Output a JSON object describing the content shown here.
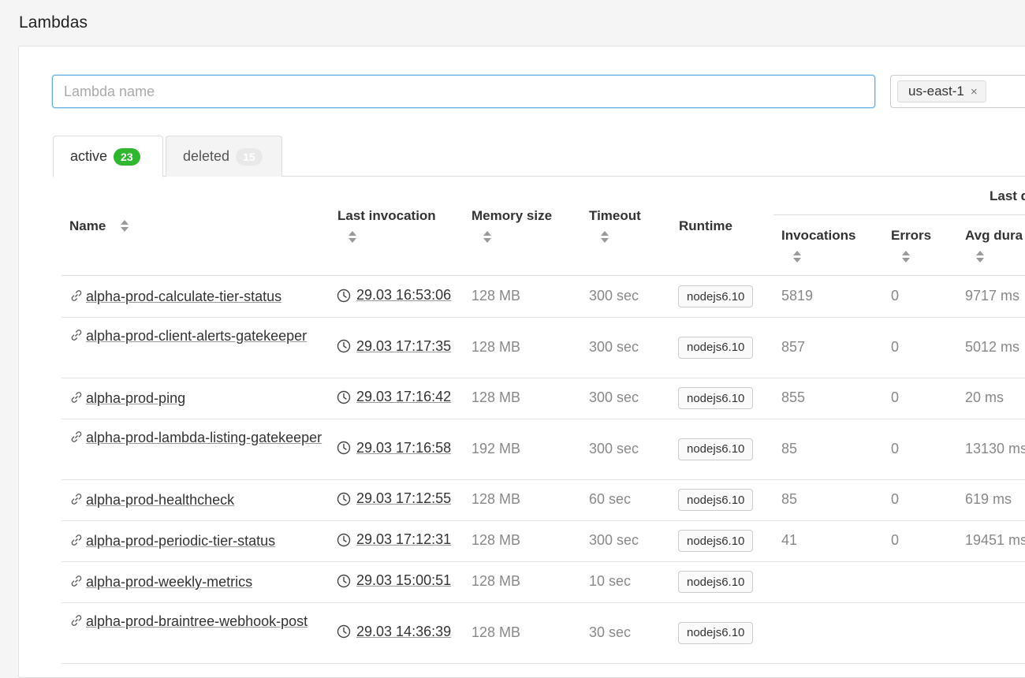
{
  "page": {
    "title": "Lambdas"
  },
  "search": {
    "placeholder": "Lambda name",
    "value": ""
  },
  "region_filter": {
    "selected": "us-east-1",
    "remove_glyph": "×"
  },
  "tabs": [
    {
      "label": "active",
      "count": "23",
      "active": true
    },
    {
      "label": "deleted",
      "count": "15",
      "active": false
    }
  ],
  "table": {
    "headers": {
      "name": "Name",
      "last_invocation": "Last invocation",
      "memory_size": "Memory size",
      "timeout": "Timeout",
      "runtime": "Runtime",
      "group": "Last d",
      "invocations": "Invocations",
      "errors": "Errors",
      "avg_duration": "Avg dura"
    },
    "rows": [
      {
        "name": "alpha-prod-calculate-tier-status",
        "last_invocation": "29.03 16:53:06",
        "memory": "128 MB",
        "timeout": "300 sec",
        "runtime": "nodejs6.10",
        "invocations": "5819",
        "errors": "0",
        "avg_duration": "9717 ms"
      },
      {
        "name": "alpha-prod-client-alerts-gatekeeper",
        "last_invocation": "29.03 17:17:35",
        "memory": "128 MB",
        "timeout": "300 sec",
        "runtime": "nodejs6.10",
        "invocations": "857",
        "errors": "0",
        "avg_duration": "5012 ms"
      },
      {
        "name": "alpha-prod-ping",
        "last_invocation": "29.03 17:16:42",
        "memory": "128 MB",
        "timeout": "300 sec",
        "runtime": "nodejs6.10",
        "invocations": "855",
        "errors": "0",
        "avg_duration": "20 ms"
      },
      {
        "name": "alpha-prod-lambda-listing-gatekeeper",
        "last_invocation": "29.03 17:16:58",
        "memory": "192 MB",
        "timeout": "300 sec",
        "runtime": "nodejs6.10",
        "invocations": "85",
        "errors": "0",
        "avg_duration": "13130 ms"
      },
      {
        "name": "alpha-prod-healthcheck",
        "last_invocation": "29.03 17:12:55",
        "memory": "128 MB",
        "timeout": "60 sec",
        "runtime": "nodejs6.10",
        "invocations": "85",
        "errors": "0",
        "avg_duration": "619 ms"
      },
      {
        "name": "alpha-prod-periodic-tier-status",
        "last_invocation": "29.03 17:12:31",
        "memory": "128 MB",
        "timeout": "300 sec",
        "runtime": "nodejs6.10",
        "invocations": "41",
        "errors": "0",
        "avg_duration": "19451 ms"
      },
      {
        "name": "alpha-prod-weekly-metrics",
        "last_invocation": "29.03 15:00:51",
        "memory": "128 MB",
        "timeout": "10 sec",
        "runtime": "nodejs6.10",
        "invocations": "",
        "errors": "",
        "avg_duration": ""
      },
      {
        "name": "alpha-prod-braintree-webhook-post",
        "last_invocation": "29.03 14:36:39",
        "memory": "128 MB",
        "timeout": "30 sec",
        "runtime": "nodejs6.10",
        "invocations": "",
        "errors": "",
        "avg_duration": ""
      }
    ]
  },
  "colors": {
    "accent_focus": "#66afe9",
    "active_badge": "#2fb72f",
    "deleted_badge": "#e9e9e9"
  },
  "icons": {
    "row_link": "link-icon",
    "row_time": "clock-icon",
    "sort": "sort-icon",
    "tag_remove": "close-icon"
  }
}
